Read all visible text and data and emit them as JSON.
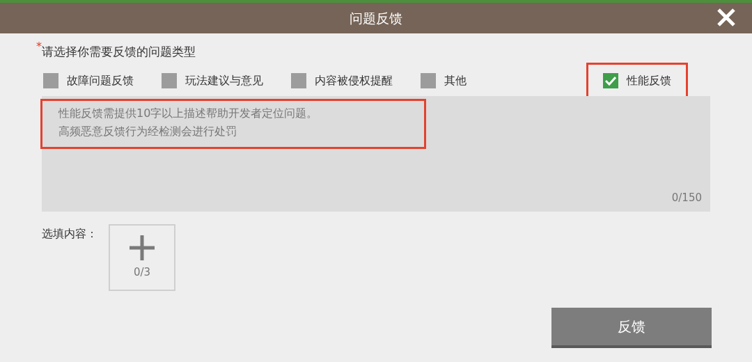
{
  "window": {
    "title": "问题反馈"
  },
  "question": {
    "required_mark": "*",
    "label": "请选择你需要反馈的问题类型"
  },
  "options": [
    {
      "label": "故障问题反馈",
      "checked": false,
      "highlighted": false
    },
    {
      "label": "玩法建议与意见",
      "checked": false,
      "highlighted": false
    },
    {
      "label": "内容被侵权提醒",
      "checked": false,
      "highlighted": false
    },
    {
      "label": "其他",
      "checked": false,
      "highlighted": false
    },
    {
      "label": "性能反馈",
      "checked": true,
      "highlighted": true
    }
  ],
  "description": {
    "placeholder_lines": [
      "性能反馈需提供10字以上描述帮助开发者定位问题。",
      "高频恶意反馈行为经检测会进行处罚"
    ],
    "counter": "0/150",
    "highlighted": true
  },
  "attachments": {
    "label": "选填内容：",
    "count": "0/3"
  },
  "submit": {
    "label": "反馈",
    "disabled": true
  }
}
